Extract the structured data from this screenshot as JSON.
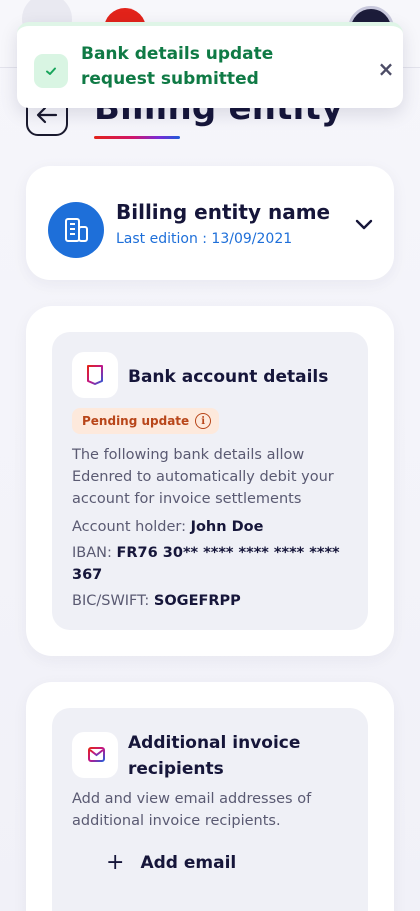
{
  "toast": {
    "message": "Bank details update request submitted",
    "close_glyph": "×",
    "color": "#0f7a45",
    "icon": "check-icon"
  },
  "header": {
    "title": "Billing entity",
    "back_icon": "arrow-left-icon"
  },
  "entity": {
    "name": "Billing entity name",
    "last_edition": "Last edition : 13/09/2021",
    "icon": "building-icon",
    "chevron": "chevron-down-icon",
    "accent": "#1e6fd9"
  },
  "bank": {
    "title": "Bank account details",
    "icon": "document-icon",
    "badge": "Pending update",
    "badge_icon": "info-icon",
    "description": "The following bank details allow Edenred to automatically debit your account for invoice settlements",
    "holder_label": "Account holder:",
    "holder_value": "John Doe",
    "iban_label": "IBAN:",
    "iban_value": "FR76 30** **** **** **** **** 367",
    "bic_label": "BIC/SWIFT:",
    "bic_value": "SOGEFRPP"
  },
  "recipients": {
    "title": "Additional invoice recipients",
    "icon": "mail-send-icon",
    "description": "Add and view email addresses of additional invoice recipients.",
    "add_label": "Add email",
    "add_glyph": "+"
  }
}
